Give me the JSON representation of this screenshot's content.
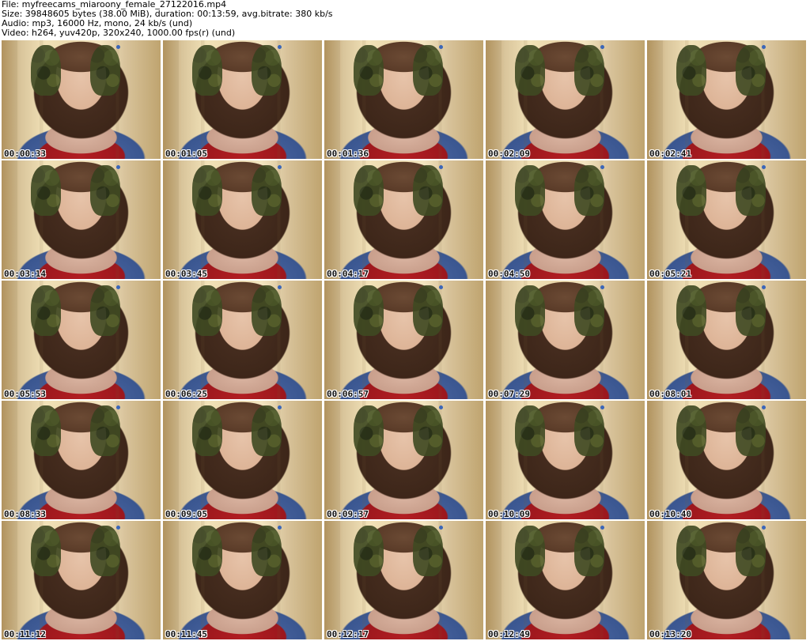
{
  "header": {
    "file_line": "File: myfreecams_miaroony_female_27122016.mp4",
    "size_line": "Size: 39848605 bytes (38.00 MiB), duration: 00:13:59, avg.bitrate: 380 kb/s",
    "audio_line": "Audio: mp3, 16000 Hz, mono, 24 kb/s (und)",
    "video_line": "Video: h264, yuv420p, 320x240, 1000.00 fps(r) (und)"
  },
  "thumbnails": [
    {
      "time": "00:00:33"
    },
    {
      "time": "00:01:05"
    },
    {
      "time": "00:01:36"
    },
    {
      "time": "00:02:09"
    },
    {
      "time": "00:02:41"
    },
    {
      "time": "00:03:14"
    },
    {
      "time": "00:03:45"
    },
    {
      "time": "00:04:17"
    },
    {
      "time": "00:04:50"
    },
    {
      "time": "00:05:21"
    },
    {
      "time": "00:05:53"
    },
    {
      "time": "00:06:25"
    },
    {
      "time": "00:06:57"
    },
    {
      "time": "00:07:29"
    },
    {
      "time": "00:08:01"
    },
    {
      "time": "00:08:33"
    },
    {
      "time": "00:09:05"
    },
    {
      "time": "00:09:37"
    },
    {
      "time": "00:10:09"
    },
    {
      "time": "00:10:40"
    },
    {
      "time": "00:11:12"
    },
    {
      "time": "00:11:45"
    },
    {
      "time": "00:12:17"
    },
    {
      "time": "00:12:49"
    },
    {
      "time": "00:13:20"
    }
  ]
}
